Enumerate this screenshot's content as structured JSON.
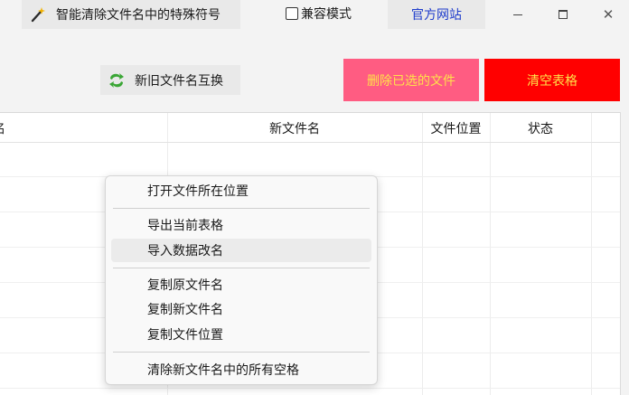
{
  "toolbar": {
    "smart_clean_label": "智能清除文件名中的特殊符号",
    "compat_label": "兼容模式",
    "official_site_label": "官方网站",
    "minimize": "–",
    "maximize": "☐",
    "close": "✕"
  },
  "actions": {
    "swap_label": "新旧文件名互换",
    "delete_selected_label": "删除已选的文件",
    "clear_table_label": "清空表格"
  },
  "table": {
    "columns": [
      "名",
      "新文件名",
      "文件位置",
      "状态"
    ]
  },
  "context_menu": {
    "items": [
      "打开文件所在位置",
      "导出当前表格",
      "导入数据改名",
      "复制原文件名",
      "复制新文件名",
      "复制文件位置",
      "清除新文件名中的所有空格"
    ]
  },
  "colors": {
    "delete_bg": "#ff5c82",
    "clear_bg": "#ff0000",
    "button_text": "#ffe24a",
    "link": "#1e3ccc"
  }
}
